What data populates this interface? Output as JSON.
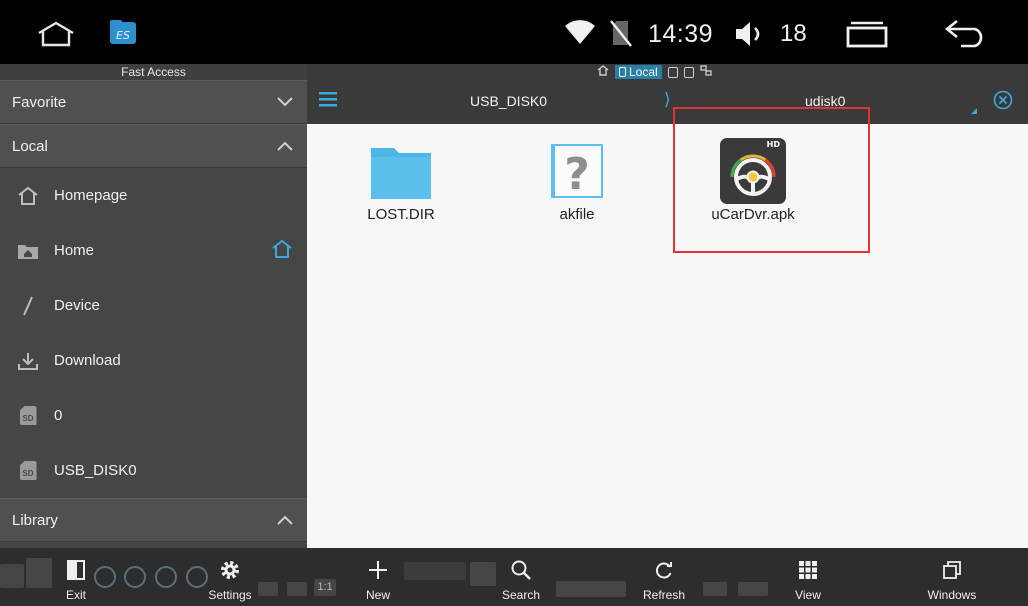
{
  "status_bar": {
    "time": "14:39",
    "volume": "18",
    "icons": [
      "home-outline-icon",
      "es-file-explorer-app-icon",
      "wifi-icon",
      "no-sim-icon",
      "volume-icon",
      "recent-apps-icon",
      "back-arrow-icon"
    ]
  },
  "left_panel": {
    "title": "Fast Access",
    "sections": {
      "favorite": "Favorite",
      "local": "Local",
      "library": "Library"
    },
    "local_items": [
      {
        "label": "Homepage",
        "icon": "home-icon"
      },
      {
        "label": "Home",
        "icon": "folder-home-icon"
      },
      {
        "label": "Device",
        "icon": "slash-device-icon"
      },
      {
        "label": "Download",
        "icon": "download-icon"
      },
      {
        "label": "0",
        "icon": "sd-card-icon"
      },
      {
        "label": "USB_DISK0",
        "icon": "sd-card-icon"
      }
    ],
    "sd_badge": "SD"
  },
  "path_bar": {
    "window_tab_active": "Local",
    "crumb_1": "USB_DISK0",
    "crumb_separator": "⟩",
    "crumb_2": "udisk0"
  },
  "files": [
    {
      "name": "LOST.DIR",
      "type": "folder"
    },
    {
      "name": "akfile",
      "type": "unknown"
    },
    {
      "name": "uCarDvr.apk",
      "type": "apk",
      "badge": "HD"
    }
  ],
  "unknown_glyph": "?",
  "toolbar": {
    "buttons": [
      {
        "label": "Exit",
        "icon": "exit-icon"
      },
      {
        "label": "Settings",
        "icon": "gear-icon"
      },
      {
        "label": "New",
        "icon": "plus-icon"
      },
      {
        "label": "Search",
        "icon": "search-icon"
      },
      {
        "label": "Refresh",
        "icon": "refresh-icon"
      },
      {
        "label": "View",
        "icon": "grid-icon"
      },
      {
        "label": "Windows",
        "icon": "windows-icon"
      }
    ],
    "ghost_ratio": "1:1"
  },
  "colors": {
    "accent": "#3aa9df",
    "panel": "#464646",
    "highlight": "#e53232",
    "folder": "#5bc0eb"
  }
}
